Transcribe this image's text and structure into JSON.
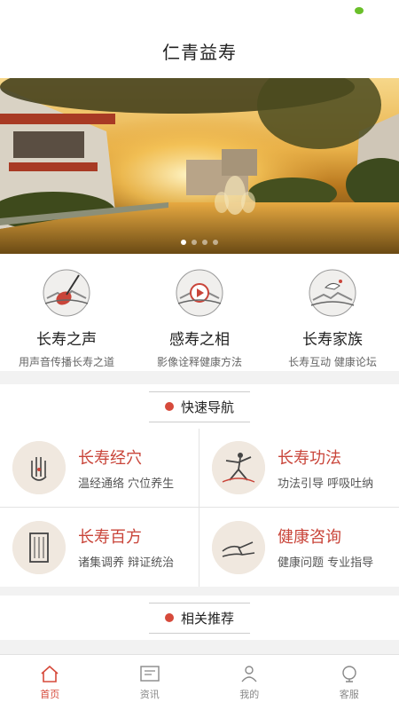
{
  "header": {
    "title": "仁青益寿"
  },
  "banner": {
    "slides": 4,
    "active_index": 0
  },
  "features": [
    {
      "title": "长寿之声",
      "subtitle": "用声音传播长寿之道",
      "icon": "pipa-instrument-icon"
    },
    {
      "title": "感寿之相",
      "subtitle": "影像诠释健康方法",
      "icon": "video-play-icon"
    },
    {
      "title": "长寿家族",
      "subtitle": "长寿互动 健康论坛",
      "icon": "crane-icon"
    }
  ],
  "quick_nav": {
    "title": "快速导航",
    "items": [
      {
        "title": "长寿经穴",
        "subtitle": "温经通络 穴位养生",
        "icon": "acupoint-hand-icon"
      },
      {
        "title": "长寿功法",
        "subtitle": "功法引导 呼吸吐纳",
        "icon": "taichi-figure-icon"
      },
      {
        "title": "长寿百方",
        "subtitle": "诸集调养 辩证统治",
        "icon": "prescription-book-icon"
      },
      {
        "title": "健康咨询",
        "subtitle": "健康问题 专业指导",
        "icon": "pulse-consult-icon"
      }
    ]
  },
  "recommend": {
    "title": "相关推荐"
  },
  "tabbar": [
    {
      "label": "首页",
      "icon": "home-icon",
      "active": true
    },
    {
      "label": "资讯",
      "icon": "news-icon",
      "active": false
    },
    {
      "label": "我的",
      "icon": "profile-icon",
      "active": false
    },
    {
      "label": "客服",
      "icon": "customer-service-icon",
      "active": false
    }
  ],
  "colors": {
    "accent": "#d64a3b",
    "title_red": "#c9453a",
    "background": "#f2f2f2"
  }
}
